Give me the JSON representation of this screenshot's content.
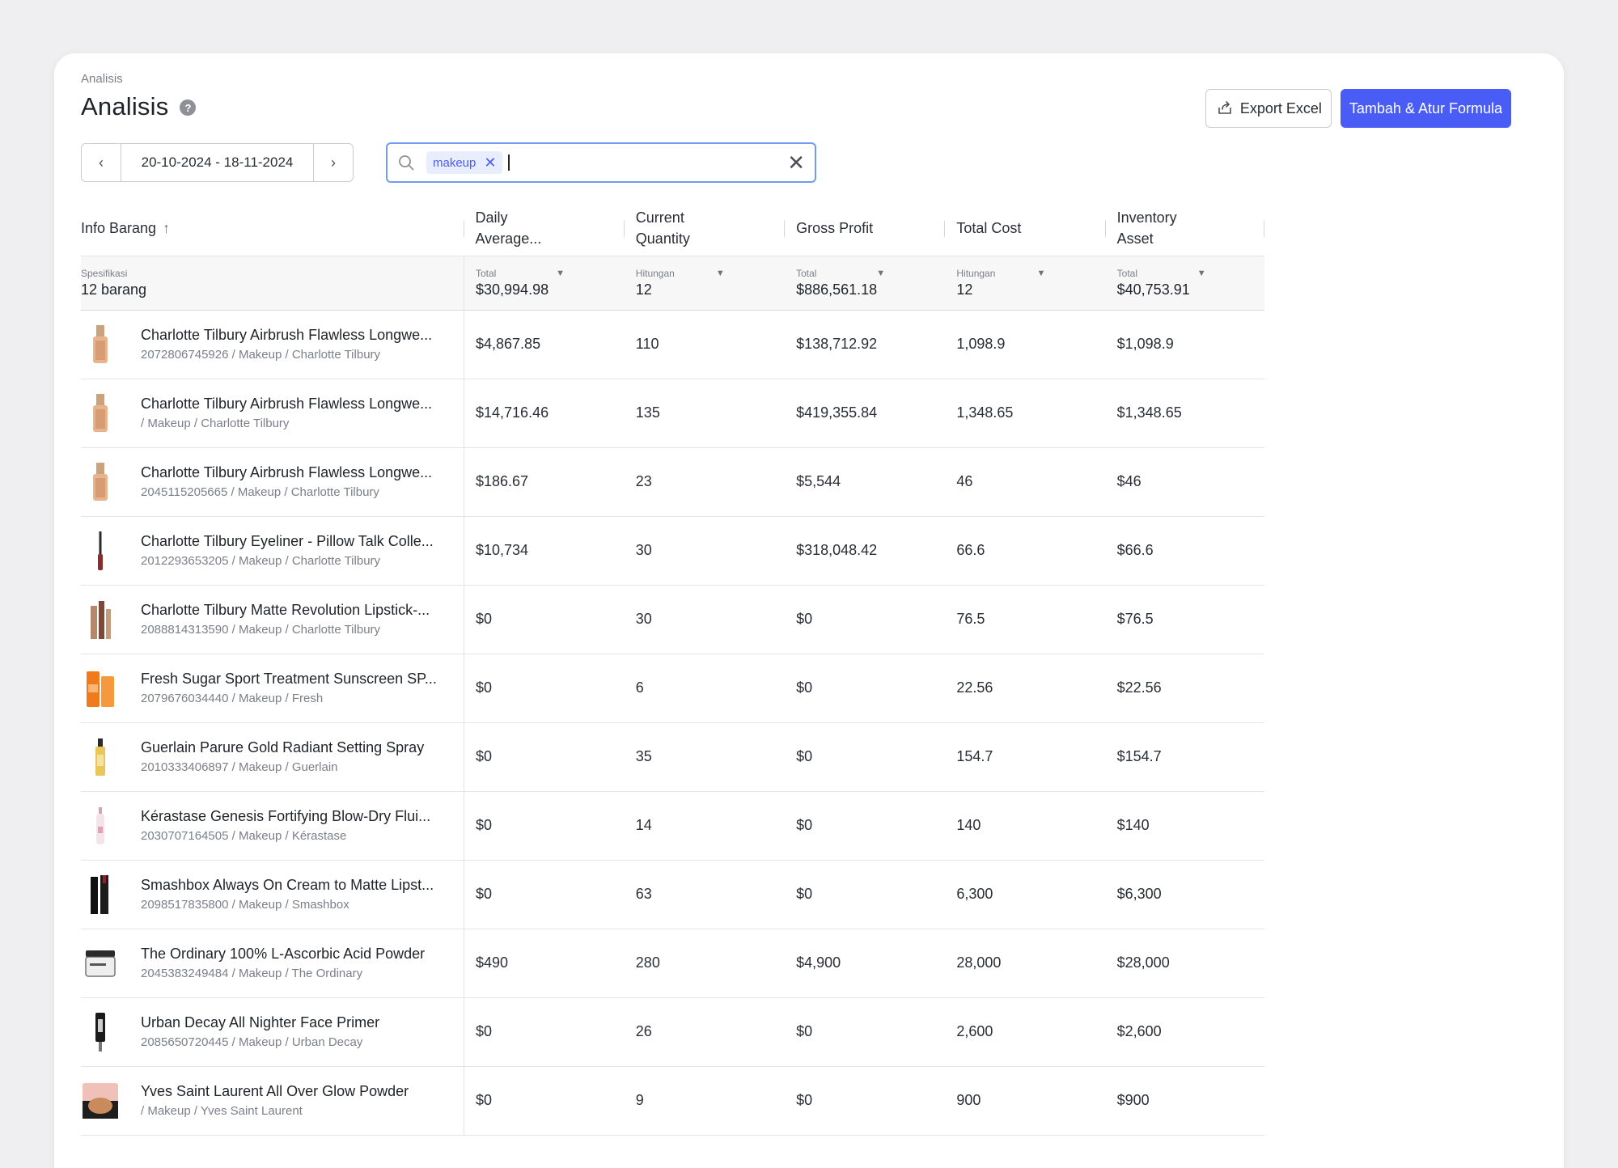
{
  "breadcrumb": "Analisis",
  "page_title": "Analisis",
  "help_icon": "?",
  "actions": {
    "export_label": "Export Excel",
    "primary_label": "Tambah & Atur Formula"
  },
  "date_range": {
    "value": "20-10-2024 - 18-11-2024",
    "prev": "‹",
    "next": "›"
  },
  "search": {
    "chip": "makeup",
    "chip_remove": "✕",
    "clear": "✕"
  },
  "columns": {
    "item": "Info Barang",
    "daily_avg": "Daily Average...",
    "current_qty": "Current Quantity",
    "gross_profit": "Gross Profit",
    "total_cost": "Total Cost",
    "inventory_asset": "Inventory Asset"
  },
  "summary": {
    "item_label": "Spesifikasi",
    "item_value": "12 barang",
    "daily_avg": {
      "label": "Total",
      "value": "$30,994.98"
    },
    "current_qty": {
      "label": "Hitungan",
      "value": "12"
    },
    "gross_profit": {
      "label": "Total",
      "value": "$886,561.18"
    },
    "total_cost": {
      "label": "Hitungan",
      "value": "12"
    },
    "inventory_asset": {
      "label": "Total",
      "value": "$40,753.91"
    }
  },
  "rows": [
    {
      "name": "Charlotte Tilbury Airbrush Flawless Longwe...",
      "meta": "2072806745926 / Makeup / Charlotte Tilbury",
      "thumb": "foundation",
      "daily_avg": "$4,867.85",
      "qty": "110",
      "profit": "$138,712.92",
      "cost": "1,098.9",
      "asset": "$1,098.9"
    },
    {
      "name": "Charlotte Tilbury Airbrush Flawless Longwe...",
      "meta": " / Makeup / Charlotte Tilbury",
      "thumb": "foundation",
      "daily_avg": "$14,716.46",
      "qty": "135",
      "profit": "$419,355.84",
      "cost": "1,348.65",
      "asset": "$1,348.65"
    },
    {
      "name": "Charlotte Tilbury Airbrush Flawless Longwe...",
      "meta": "2045115205665 / Makeup / Charlotte Tilbury",
      "thumb": "foundation",
      "daily_avg": "$186.67",
      "qty": "23",
      "profit": "$5,544",
      "cost": "46",
      "asset": "$46"
    },
    {
      "name": "Charlotte Tilbury Eyeliner - Pillow Talk Colle...",
      "meta": "2012293653205 / Makeup / Charlotte Tilbury",
      "thumb": "eyeliner",
      "daily_avg": "$10,734",
      "qty": "30",
      "profit": "$318,048.42",
      "cost": "66.6",
      "asset": "$66.6"
    },
    {
      "name": "Charlotte Tilbury Matte Revolution Lipstick-...",
      "meta": "2088814313590 / Makeup / Charlotte Tilbury",
      "thumb": "lipstick",
      "daily_avg": "$0",
      "qty": "30",
      "profit": "$0",
      "cost": "76.5",
      "asset": "$76.5"
    },
    {
      "name": "Fresh Sugar Sport Treatment Sunscreen SP...",
      "meta": "2079676034440 / Makeup / Fresh",
      "thumb": "sunscreen",
      "daily_avg": "$0",
      "qty": "6",
      "profit": "$0",
      "cost": "22.56",
      "asset": "$22.56"
    },
    {
      "name": "Guerlain Parure Gold Radiant Setting Spray",
      "meta": "2010333406897 / Makeup / Guerlain",
      "thumb": "spray",
      "daily_avg": "$0",
      "qty": "35",
      "profit": "$0",
      "cost": "154.7",
      "asset": "$154.7"
    },
    {
      "name": "Kérastase Genesis Fortifying Blow-Dry Flui...",
      "meta": "2030707164505 / Makeup / Kérastase",
      "thumb": "bottle",
      "daily_avg": "$0",
      "qty": "14",
      "profit": "$0",
      "cost": "140",
      "asset": "$140"
    },
    {
      "name": "Smashbox Always On Cream to Matte Lipst...",
      "meta": "2098517835800 / Makeup / Smashbox",
      "thumb": "black-lipstick",
      "daily_avg": "$0",
      "qty": "63",
      "profit": "$0",
      "cost": "6,300",
      "asset": "$6,300"
    },
    {
      "name": "The Ordinary 100% L-Ascorbic Acid Powder",
      "meta": "2045383249484 / Makeup / The Ordinary",
      "thumb": "jar",
      "daily_avg": "$490",
      "qty": "280",
      "profit": "$4,900",
      "cost": "28,000",
      "asset": "$28,000"
    },
    {
      "name": "Urban Decay All Nighter Face Primer",
      "meta": "2085650720445 / Makeup / Urban Decay",
      "thumb": "primer",
      "daily_avg": "$0",
      "qty": "26",
      "profit": "$0",
      "cost": "2,600",
      "asset": "$2,600"
    },
    {
      "name": "Yves Saint Laurent All Over Glow Powder",
      "meta": " / Makeup / Yves Saint Laurent",
      "thumb": "compact",
      "daily_avg": "$0",
      "qty": "9",
      "profit": "$0",
      "cost": "900",
      "asset": "$900"
    }
  ],
  "colors": {
    "primary": "#4a5cf6",
    "search_border": "#6f9cf1",
    "chip_bg": "#e8edff"
  }
}
